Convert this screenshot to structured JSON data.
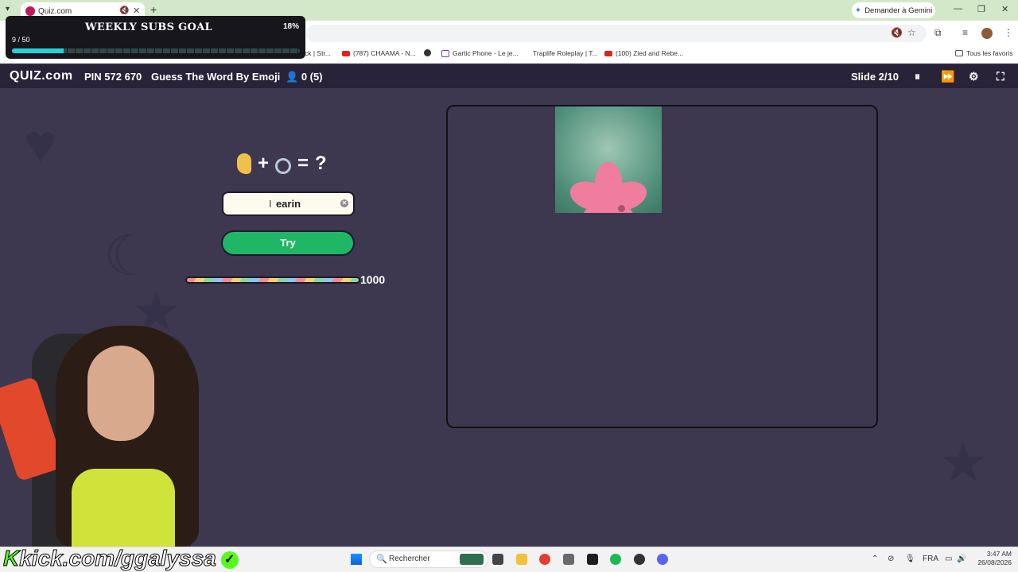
{
  "browser": {
    "tab_title": "Quiz.com",
    "gemini_label": "Demander à Gemini",
    "bookmarks": [
      {
        "label": "ck | Str..."
      },
      {
        "label": "(787) CHAAMA - N..."
      },
      {
        "label": ""
      },
      {
        "label": "Gartic Phone - Le je..."
      },
      {
        "label": "Traplife Roleplay | T..."
      },
      {
        "label": "(100) Zied and Rebe..."
      }
    ],
    "favorites_label": "Tous les favoris"
  },
  "goal_overlay": {
    "title": "WEEKLY SUBS GOAL",
    "percent_label": "18%",
    "count_label": "9 / 50",
    "progress": 0.18,
    "colors": {
      "fill": "#27d0d8",
      "background": "#16161c"
    }
  },
  "game_header": {
    "logo": "QUIZ.com",
    "pin": "PIN 572 670",
    "game_name": "Guess The Word By Emoji",
    "players": "0 (5)",
    "slide": "Slide 2/10"
  },
  "question": {
    "plus": "+",
    "equals": "=",
    "mark": "?",
    "icons": [
      "ear-icon",
      "ring-icon"
    ]
  },
  "answer": {
    "value": "earin"
  },
  "try_label": "Try",
  "timer": {
    "value": "1000",
    "progress": 1.0
  },
  "overlay_brand": {
    "text": "kick.com/ggalyssa"
  },
  "taskbar": {
    "search_placeholder": "Rechercher",
    "lang": "FRA",
    "time": "3:47 AM",
    "date": "26/08/2026"
  },
  "colors": {
    "stage_bg": "#3d3850",
    "header_bg": "#282338",
    "try_button": "#1fb766",
    "kick_green": "#53fc18"
  }
}
